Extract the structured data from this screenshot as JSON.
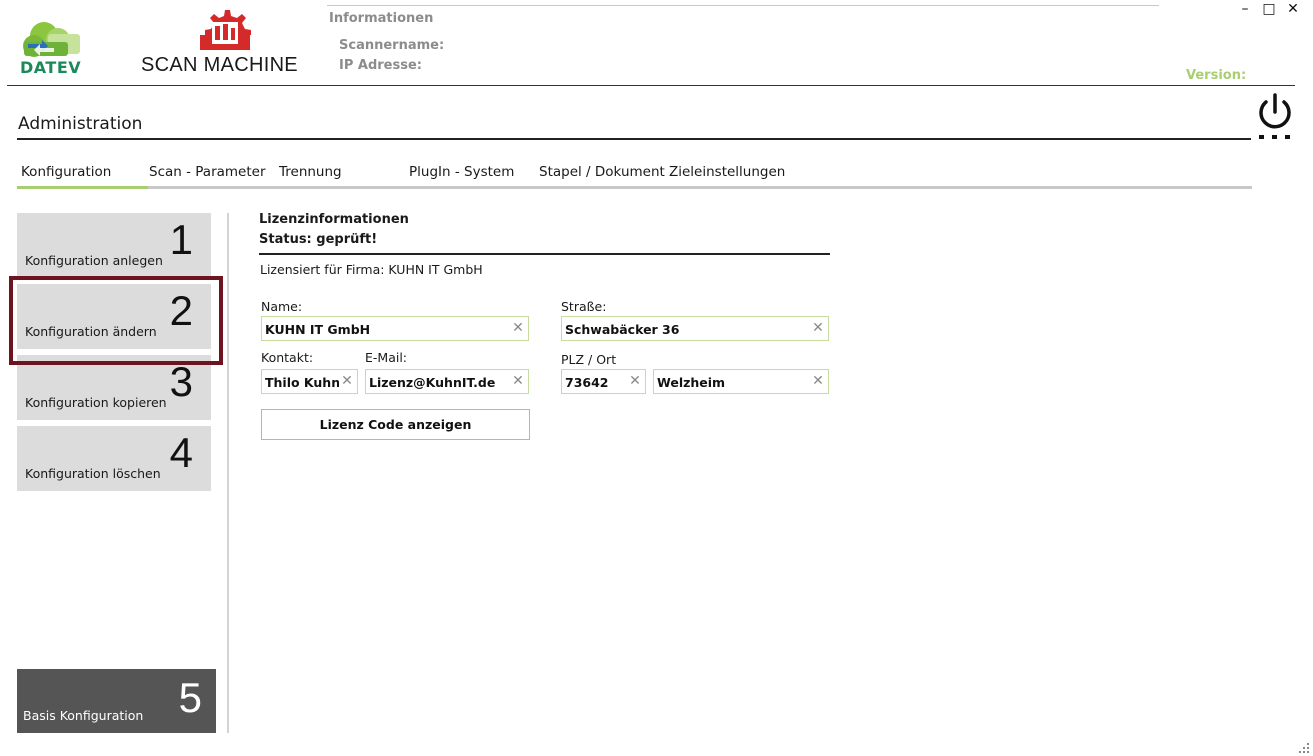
{
  "header": {
    "datev_logo_text": "DATEV",
    "scan_machine_logo_text": "SCAN MACHINE",
    "info_title": "Informationen",
    "scanner_label": "Scannername:",
    "ip_label": "IP Adresse:",
    "version_label": "Version:",
    "window_minimize": "–",
    "window_maximize": "□",
    "window_close": "✕"
  },
  "admin_title": "Administration",
  "tabs": [
    {
      "label": "Konfiguration",
      "active": true
    },
    {
      "label": "Scan - Parameter"
    },
    {
      "label": "Trennung"
    },
    {
      "label": "PlugIn - System"
    },
    {
      "label": "Stapel / Dokument"
    },
    {
      "label": "Zieleinstellungen"
    }
  ],
  "side_menu": {
    "items": [
      {
        "label": "Konfiguration anlegen",
        "number": "1"
      },
      {
        "label": "Konfiguration ändern",
        "number": "2",
        "selected": true
      },
      {
        "label": "Konfiguration kopieren",
        "number": "3"
      },
      {
        "label": "Konfiguration löschen",
        "number": "4"
      }
    ],
    "basis": {
      "label": "Basis Konfiguration",
      "number": "5"
    }
  },
  "license": {
    "title": "Lizenzinformationen",
    "status": "Status: geprüft!",
    "company_line": "Lizensiert für Firma: KUHN IT GmbH",
    "name_label": "Name:",
    "name_value": "KUHN IT GmbH",
    "street_label": "Straße:",
    "street_value": "Schwabäcker 36",
    "contact_label": "Kontakt:",
    "contact_value": "Thilo Kuhn",
    "email_label": "E-Mail:",
    "email_value": "Lizenz@KuhnIT.de",
    "plz_label": "PLZ / Ort",
    "plz_value": "73642",
    "city_value": "Welzheim",
    "show_code_button": "Lizenz Code anzeigen",
    "clear_glyph": "✕"
  },
  "colors": {
    "accent_green": "#a8cf6f",
    "selection_border": "#6d1420",
    "basis_bg": "#555555",
    "menu_bg": "#dcdcdc"
  }
}
